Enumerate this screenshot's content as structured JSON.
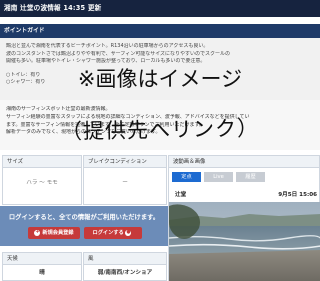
{
  "header": {
    "title": "湘南 辻堂の波情報 14:35 更新"
  },
  "guide": {
    "heading": "ポイントガイド",
    "lines": [
      "鵠沼と並んで湘南を代表するビーチポイント。R134沿いの駐車場からのアクセスも良い。",
      "波のコンスタントさでは鵠沼よりやや有利で、サーフィン可能なサイズになりやすいのでスクールの",
      "開催も多い。駐車場やトイレ・シャワー施設が整っており、ローカルも多いので要注意。",
      "○トイレ：有り",
      "○シャワー：有り"
    ]
  },
  "watermark": {
    "line1": "※画像はイメージ",
    "line2": "（提供先へリンク）"
  },
  "intro": {
    "lines": [
      "湘南のサーフィンスポット辻堂の最新波情報。",
      "サーフィン経験の豊富なスタッフによる現地の詳細なコンディション、波予報、アドバイスなどを提供してい",
      "ます。豊富なサーフィン情報を完備しています。全て定額プランでご利用いただけます。",
      "解析データのみでなく、現地からのコンテンツもご覧いただけます。"
    ]
  },
  "panels": {
    "size": {
      "label": "サイズ",
      "value": "ハラ ～ モモ"
    },
    "break": {
      "label": "ブレイクコンディション",
      "value": "ー"
    },
    "weather": {
      "label": "天候",
      "value": "晴"
    },
    "wind": {
      "label": "風",
      "value": "弱/南南西/オンショア"
    }
  },
  "login": {
    "message": "ログインすると、全ての情報がご利用いただけます。",
    "register_label": "新規会員登録",
    "login_label": "ログインする"
  },
  "camera": {
    "title": "波動画＆画像",
    "tabs": [
      "定点",
      "Live",
      "履歴"
    ],
    "active_tab": 0,
    "location": "辻堂",
    "date": "9月5日 15:06"
  },
  "colors": {
    "header": "#16233f",
    "guide_bar": "#1e3a68",
    "accent": "#1d6bd1",
    "login_bg": "#6c8cb8",
    "button": "#c63a3a"
  }
}
